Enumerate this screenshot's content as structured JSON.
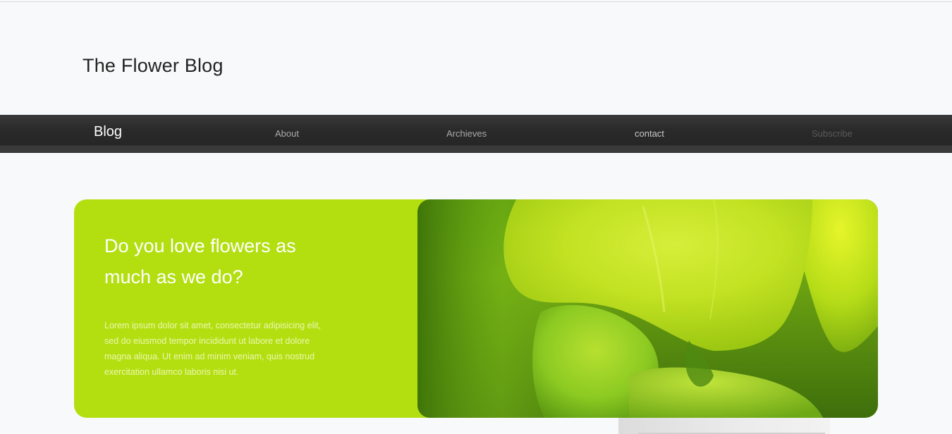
{
  "site": {
    "title": "The Flower Blog"
  },
  "nav": {
    "brand": "Blog",
    "items": [
      {
        "label": "About"
      },
      {
        "label": "Archieves"
      },
      {
        "label": "contact"
      },
      {
        "label": "Subscribe"
      }
    ]
  },
  "hero": {
    "heading": "Do you love flowers as much as we do?",
    "body": "Lorem ipsum dolor sit amet, consectetur adipisicing elit, sed do eiusmod tempor incididunt ut labore et dolore magna aliqua. Ut enim ad minim veniam, quis nostrud exercitation ullamco laboris nisi ut.",
    "image_icon": "flower-photo",
    "accent_color": "#b3df10"
  },
  "colors": {
    "page_background": "#f8f9fa",
    "navbar": "#2a2a2a",
    "hero_panel": "#b3df10"
  }
}
